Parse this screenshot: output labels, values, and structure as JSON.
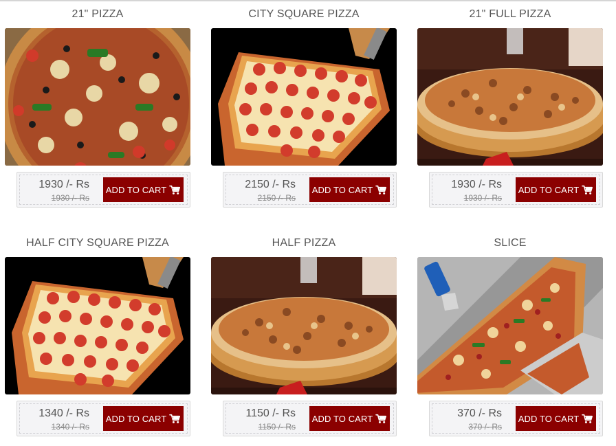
{
  "products": [
    {
      "name": "21\" PIZZA",
      "price": "1930 /- Rs",
      "old_price": "1930 /- Rs",
      "button_label": "ADD TO CART",
      "image": "round-veggie-pizza"
    },
    {
      "name": "CITY SQUARE PIZZA",
      "price": "2150 /- Rs",
      "old_price": "2150 /- Rs",
      "button_label": "ADD TO CART",
      "image": "square-pepperoni-pizza"
    },
    {
      "name": "21\" FULL PIZZA",
      "price": "1930 /- Rs",
      "old_price": "1930 /- Rs",
      "button_label": "ADD TO CART",
      "image": "round-pizza-on-board"
    },
    {
      "name": "HALF CITY SQUARE PIZZA",
      "price": "1340 /- Rs",
      "old_price": "1340 /- Rs",
      "button_label": "ADD TO CART",
      "image": "square-pepperoni-pizza"
    },
    {
      "name": "HALF PIZZA",
      "price": "1150 /- Rs",
      "old_price": "1150 /- Rs",
      "button_label": "ADD TO CART",
      "image": "round-pizza-on-board"
    },
    {
      "name": "SLICE",
      "price": "370 /- Rs",
      "old_price": "370 /- Rs",
      "button_label": "ADD TO CART",
      "image": "pizza-slice-served"
    }
  ],
  "colors": {
    "button": "#8b0000",
    "button_text": "#ffffff",
    "title_text": "#555555",
    "price_box": "#f4f4f6"
  },
  "icons": {
    "cart": "shopping-cart-icon"
  }
}
